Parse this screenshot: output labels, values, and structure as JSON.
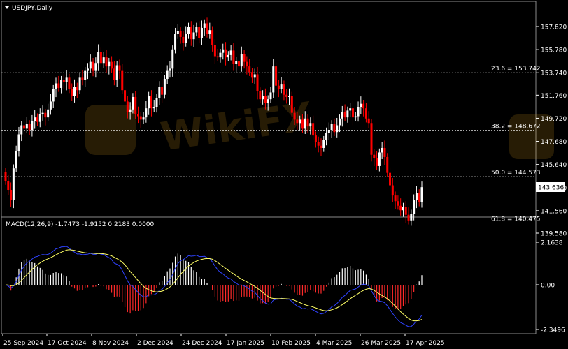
{
  "chart_data": {
    "type": "candlestick",
    "title": "USDJPY,Daily",
    "current_price": "143.636",
    "price_ylim": [
      139.58,
      158.5
    ],
    "price_ticks": [
      "157.820",
      "155.780",
      "153.740",
      "151.760",
      "149.720",
      "147.680",
      "145.640",
      "143.600",
      "141.560",
      "139.580"
    ],
    "x_labels": [
      "25 Sep 2024",
      "17 Oct 2024",
      "8 Nov 2024",
      "2 Dec 2024",
      "24 Dec 2024",
      "17 Jan 2025",
      "10 Feb 2025",
      "4 Mar 2025",
      "26 Mar 2025",
      "17 Apr 2025"
    ],
    "fib_levels": [
      {
        "label": "23.6 = 153.742",
        "value": 153.742
      },
      {
        "label": "38.2 = 148.672",
        "value": 148.672
      },
      {
        "label": "50.0 = 144.573",
        "value": 144.573
      },
      {
        "label": "61.8 = 140.475",
        "value": 140.475
      }
    ],
    "closes": [
      144.2,
      143.4,
      142.5,
      145.3,
      146.8,
      148.3,
      149.1,
      148.8,
      149.2,
      148.7,
      149.5,
      149.8,
      149.4,
      150.1,
      150.2,
      149.8,
      150.5,
      151.2,
      152.3,
      152.8,
      152.4,
      153.1,
      152.9,
      153.3,
      152.3,
      151.7,
      152.5,
      152.2,
      153.3,
      153.1,
      153.9,
      154.1,
      154.7,
      153.9,
      154.6,
      155.6,
      154.6,
      155.1,
      154.3,
      154.7,
      154.1,
      153.1,
      154.4,
      153.9,
      152.2,
      151.2,
      150.3,
      150.5,
      151.6,
      150.1,
      149.9,
      149.6,
      149.8,
      150.6,
      151.7,
      150.6,
      150.7,
      151.5,
      152.5,
      151.8,
      153.2,
      153.9,
      154.1,
      155.8,
      157.2,
      157.4,
      156.9,
      156.4,
      157.2,
      157.8,
      156.7,
      157.3,
      157.8,
      156.8,
      157.7,
      158.1,
      157.2,
      157.5,
      156.2,
      155.2,
      155.1,
      155.5,
      155.8,
      155.1,
      155.3,
      155.7,
      154.5,
      154.8,
      154.3,
      155.4,
      154.7,
      154.3,
      153.8,
      153.3,
      153.6,
      152.1,
      151.4,
      151.7,
      151.1,
      151.4,
      152.0,
      154.3,
      152.6,
      152.3,
      152.7,
      151.8,
      151.6,
      151.7,
      150.2,
      149.6,
      149.3,
      149.6,
      148.8,
      149.7,
      149.0,
      149.3,
      148.2,
      147.6,
      147.3,
      147.1,
      147.8,
      148.4,
      148.7,
      149.2,
      148.5,
      149.1,
      149.7,
      150.3,
      149.8,
      150.4,
      150.6,
      149.8,
      149.9,
      150.7,
      151.0,
      150.6,
      149.7,
      149.3,
      146.5,
      146.2,
      145.5,
      146.7,
      147.1,
      146.3,
      144.9,
      143.8,
      142.9,
      142.4,
      142.0,
      141.6,
      141.9,
      141.2,
      140.7,
      141.3,
      142.5,
      143.1,
      142.3,
      143.636
    ]
  },
  "macd": {
    "label": "MACD(12,26,9) -1.7473 -1.9152 0.2183 0.0000",
    "ylim": [
      -2.3496,
      2.1638
    ],
    "ticks": [
      "2.1638",
      "0.00",
      "-2.3496"
    ]
  },
  "watermark": "WikiFX",
  "colors": {
    "background": "#000000",
    "up_candle": "#ffffff",
    "down_candle": "#ff0000",
    "macd_line": "#2f43ff",
    "signal_line": "#ffff66",
    "histogram_pos": "#ffffff",
    "histogram_neg": "#ff2a2a",
    "grid": "#ffffff"
  }
}
